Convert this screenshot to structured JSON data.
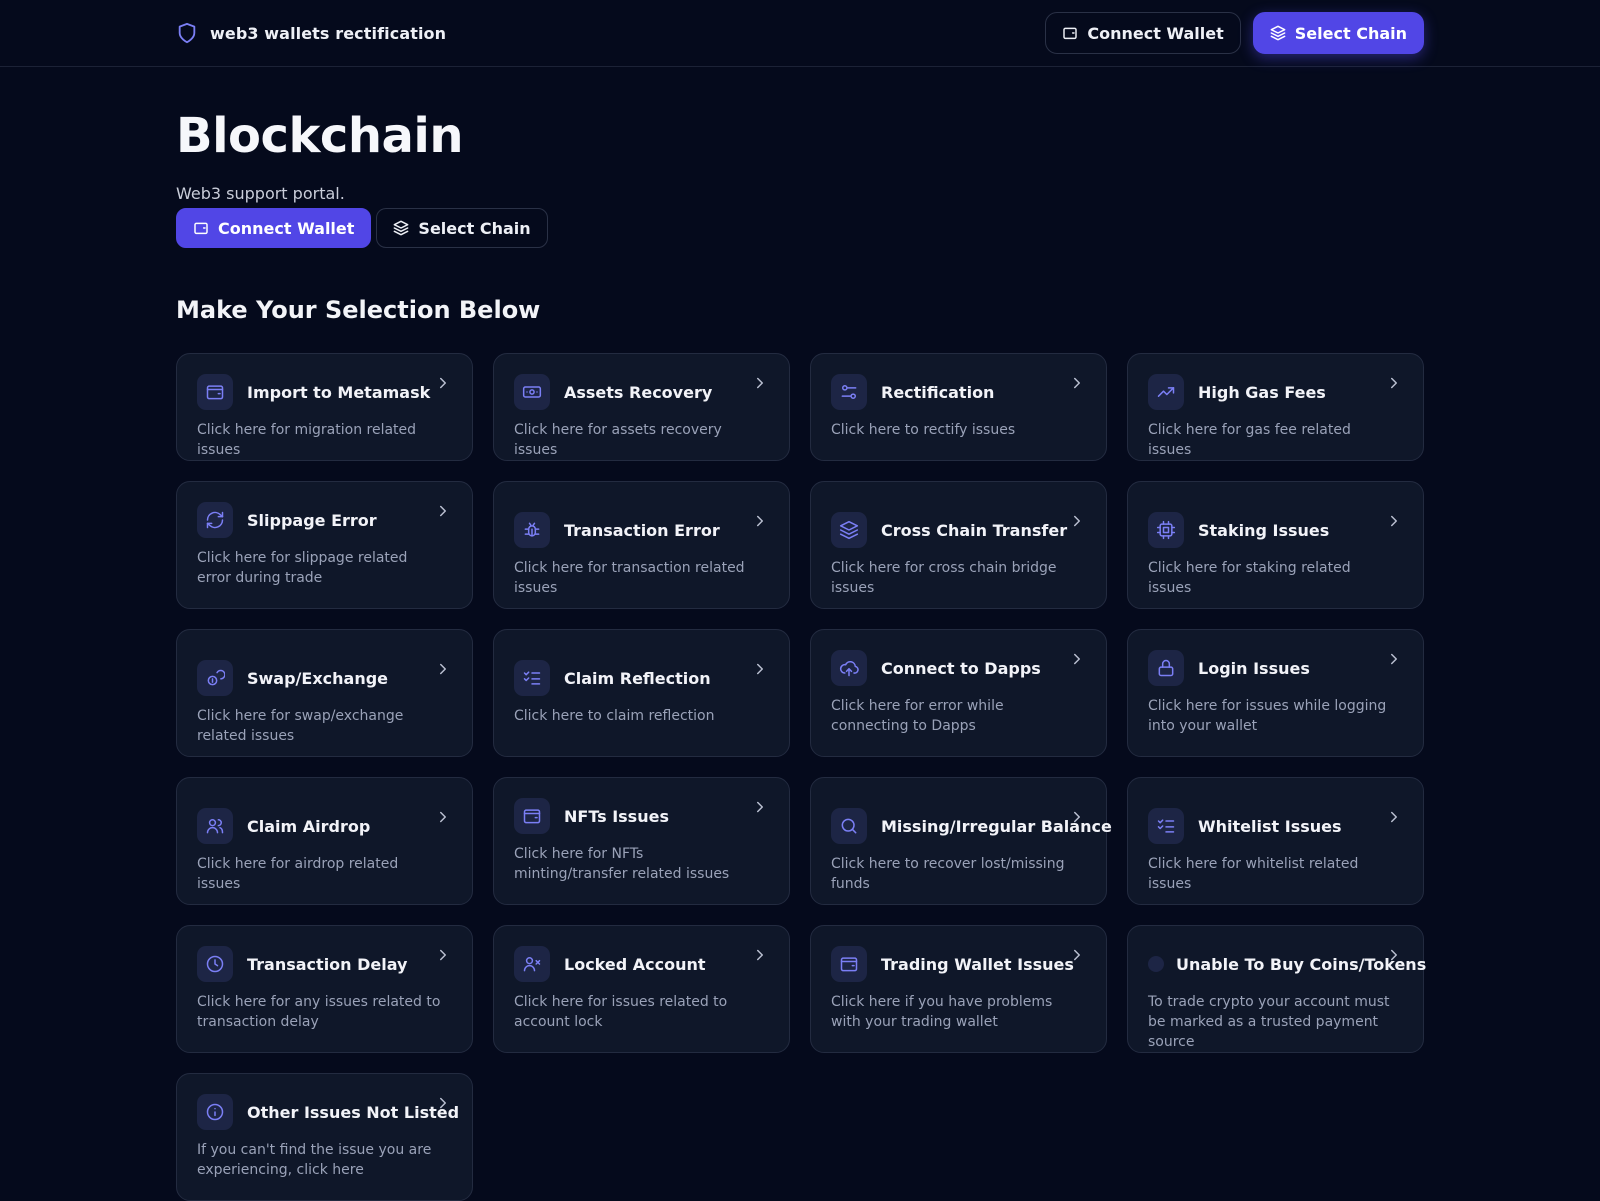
{
  "header": {
    "brand_name": "web3 wallets rectification",
    "connect_label": "Connect Wallet",
    "chain_label": "Select Chain"
  },
  "hero": {
    "title": "Blockchain",
    "subtitle": "Web3 support portal.",
    "connect_label": "Connect Wallet",
    "chain_label": "Select Chain"
  },
  "section": {
    "title": "Make Your Selection Below"
  },
  "colors": {
    "background": "#050a1c",
    "card": "#0f1729",
    "accent": "#5146e6",
    "icon": "#7b7ff5"
  },
  "cards": [
    {
      "title": "Import to Metamask",
      "desc": "Click here for migration related issues",
      "icon": "wallet-icon"
    },
    {
      "title": "Assets Recovery",
      "desc": "Click here for assets recovery issues",
      "icon": "banknote-icon"
    },
    {
      "title": "Rectification",
      "desc": "Click here to rectify issues",
      "icon": "sliders-icon"
    },
    {
      "title": "High Gas Fees",
      "desc": "Click here for gas fee related issues",
      "icon": "trending-up-icon"
    },
    {
      "title": "Slippage Error",
      "desc": "Click here for slippage related error during trade",
      "icon": "refresh-icon"
    },
    {
      "title": "Transaction Error",
      "desc": "Click here for transaction related issues",
      "icon": "bug-icon"
    },
    {
      "title": "Cross Chain Transfer",
      "desc": "Click here for cross chain bridge issues",
      "icon": "layers-icon"
    },
    {
      "title": "Staking Issues",
      "desc": "Click here for staking related issues",
      "icon": "cpu-icon"
    },
    {
      "title": "Swap/Exchange",
      "desc": "Click here for swap/exchange related issues",
      "icon": "coins-icon"
    },
    {
      "title": "Claim Reflection",
      "desc": "Click here to claim reflection",
      "icon": "list-checks-icon"
    },
    {
      "title": "Connect to Dapps",
      "desc": "Click here for error while connecting to Dapps",
      "icon": "cloud-upload-icon"
    },
    {
      "title": "Login Issues",
      "desc": "Click here for issues while logging into your wallet",
      "icon": "lock-icon"
    },
    {
      "title": "Claim Airdrop",
      "desc": "Click here for airdrop related issues",
      "icon": "users-icon"
    },
    {
      "title": "NFTs Issues",
      "desc": "Click here for NFTs minting/transfer related issues",
      "icon": "wallet-icon"
    },
    {
      "title": "Missing/Irregular Balance",
      "desc": "Click here to recover lost/missing funds",
      "icon": "search-icon"
    },
    {
      "title": "Whitelist Issues",
      "desc": "Click here for whitelist related issues",
      "icon": "list-checks-icon"
    },
    {
      "title": "Transaction Delay",
      "desc": "Click here for any issues related to transaction delay",
      "icon": "clock-icon"
    },
    {
      "title": "Locked Account",
      "desc": "Click here for issues related to account lock",
      "icon": "user-x-icon"
    },
    {
      "title": "Trading Wallet Issues",
      "desc": "Click here if you have problems with your trading wallet",
      "icon": "wallet-icon"
    },
    {
      "title": "Unable To Buy Coins/Tokens",
      "desc": "To trade crypto your account must be marked as a trusted payment source",
      "icon": "dot-icon"
    },
    {
      "title": "Other Issues Not Listed",
      "desc": "If you can't find the issue you are experiencing, click here",
      "icon": "info-icon"
    }
  ]
}
